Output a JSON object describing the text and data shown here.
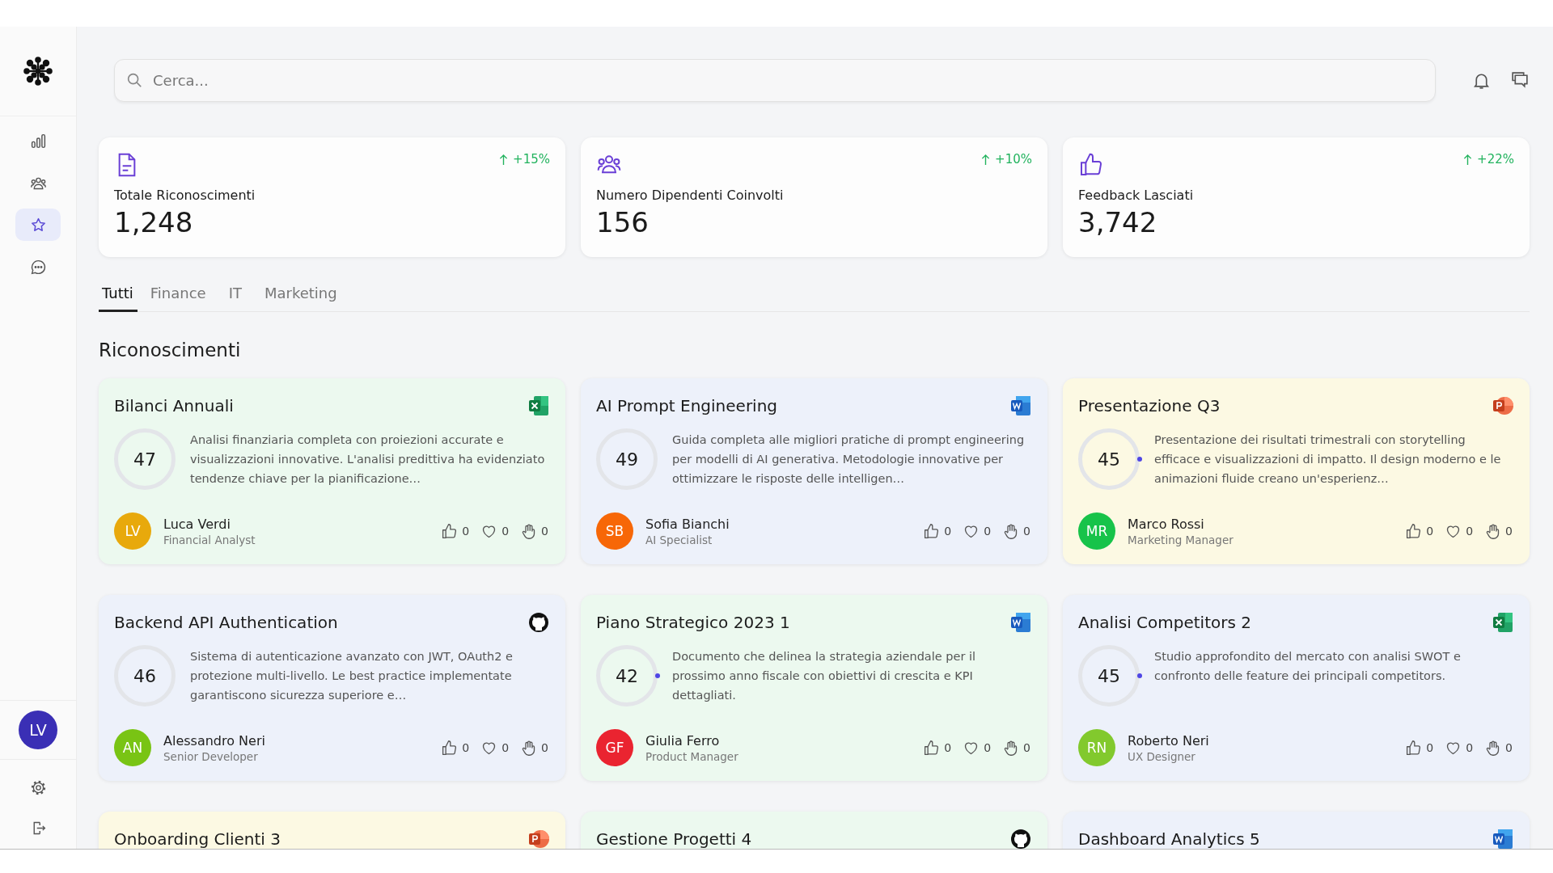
{
  "sidebar": {
    "nav": [
      {
        "kind": "chart",
        "selected": false
      },
      {
        "kind": "users",
        "selected": false
      },
      {
        "kind": "star",
        "selected": true
      },
      {
        "kind": "chat",
        "selected": false
      }
    ],
    "user": {
      "initials": "LV"
    },
    "bottom": [
      {
        "kind": "settings"
      },
      {
        "kind": "logout"
      }
    ]
  },
  "search": {
    "placeholder": "Cerca..."
  },
  "stats": [
    {
      "kind": "document",
      "label": "Totale Riconoscimenti",
      "value": "1,248",
      "change": "+15%"
    },
    {
      "kind": "users",
      "label": "Numero Dipendenti Coinvolti",
      "value": "156",
      "change": "+10%"
    },
    {
      "kind": "like",
      "label": "Feedback Lasciati",
      "value": "3,742",
      "change": "+22%"
    }
  ],
  "tabs": [
    {
      "label": "Tutti",
      "selected": true
    },
    {
      "label": "Finance",
      "selected": false
    },
    {
      "label": "IT",
      "selected": false
    },
    {
      "label": "Marketing",
      "selected": false
    }
  ],
  "section_title": "Riconoscimenti",
  "cards": [
    {
      "title": "Bilanci Annuali",
      "kind": "excel",
      "color": "#ecf9ef",
      "score": "47",
      "marker": false,
      "description": "Analisi finanziaria completa con proiezioni accurate e visualizzazioni innovative. L'analisi predittiva ha evidenziato tendenze chiave per la pianificazione…",
      "author": {
        "initials": "LV",
        "name": "Luca Verdi",
        "role": "Financial Analyst",
        "color": "#e8a90c"
      },
      "reactions": [
        {
          "kind": "like",
          "count": "0"
        },
        {
          "kind": "heart",
          "count": "0"
        },
        {
          "kind": "hand",
          "count": "0"
        }
      ]
    },
    {
      "title": "AI Prompt Engineering",
      "kind": "word",
      "color": "#edf1fa",
      "score": "49",
      "marker": false,
      "description": "Guida completa alle migliori pratiche di prompt engineering per modelli di AI generativa. Metodologie innovative per ottimizzare le risposte delle intelligen…",
      "author": {
        "initials": "SB",
        "name": "Sofia Bianchi",
        "role": "AI Specialist",
        "color": "#f76707"
      },
      "reactions": [
        {
          "kind": "like",
          "count": "0"
        },
        {
          "kind": "heart",
          "count": "0"
        },
        {
          "kind": "hand",
          "count": "0"
        }
      ]
    },
    {
      "title": "Presentazione Q3",
      "kind": "powerpoint",
      "color": "#fcf9e3",
      "score": "45",
      "marker": true,
      "description": "Presentazione dei risultati trimestrali con storytelling efficace e visualizzazioni di impatto. Il design moderno e le animazioni fluide creano un'esperienz…",
      "author": {
        "initials": "MR",
        "name": "Marco Rossi",
        "role": "Marketing Manager",
        "color": "#17c34a"
      },
      "reactions": [
        {
          "kind": "like",
          "count": "0"
        },
        {
          "kind": "heart",
          "count": "0"
        },
        {
          "kind": "hand",
          "count": "0"
        }
      ]
    },
    {
      "title": "Backend API Authentication",
      "kind": "github",
      "color": "#edf1fa",
      "score": "46",
      "marker": false,
      "description": "Sistema di autenticazione avanzato con JWT, OAuth2 e protezione multi-livello. Le best practice implementate garantiscono sicurezza superiore e…",
      "author": {
        "initials": "AN",
        "name": "Alessandro Neri",
        "role": "Senior Developer",
        "color": "#79c414"
      },
      "reactions": [
        {
          "kind": "like",
          "count": "0"
        },
        {
          "kind": "heart",
          "count": "0"
        },
        {
          "kind": "hand",
          "count": "0"
        }
      ]
    },
    {
      "title": "Piano Strategico 2023 1",
      "kind": "word",
      "color": "#ecf9ef",
      "score": "42",
      "marker": true,
      "description": "Documento che delinea la strategia aziendale per il prossimo anno fiscale con obiettivi di crescita e KPI dettagliati.",
      "author": {
        "initials": "GF",
        "name": "Giulia Ferro",
        "role": "Product Manager",
        "color": "#ea2430"
      },
      "reactions": [
        {
          "kind": "like",
          "count": "0"
        },
        {
          "kind": "heart",
          "count": "0"
        },
        {
          "kind": "hand",
          "count": "0"
        }
      ]
    },
    {
      "title": "Analisi Competitors 2",
      "kind": "excel",
      "color": "#edf1fa",
      "score": "45",
      "marker": true,
      "description": "Studio approfondito del mercato con analisi SWOT e confronto delle feature dei principali competitors.",
      "author": {
        "initials": "RN",
        "name": "Roberto Neri",
        "role": "UX Designer",
        "color": "#82c92d"
      },
      "reactions": [
        {
          "kind": "like",
          "count": "0"
        },
        {
          "kind": "heart",
          "count": "0"
        },
        {
          "kind": "hand",
          "count": "0"
        }
      ]
    },
    {
      "title": "Onboarding Clienti 3",
      "kind": "powerpoint",
      "color": "#fcf9e3"
    },
    {
      "title": "Gestione Progetti 4",
      "kind": "github",
      "color": "#ecf9ef"
    },
    {
      "title": "Dashboard Analytics 5",
      "kind": "word",
      "color": "#edf1fa"
    }
  ]
}
